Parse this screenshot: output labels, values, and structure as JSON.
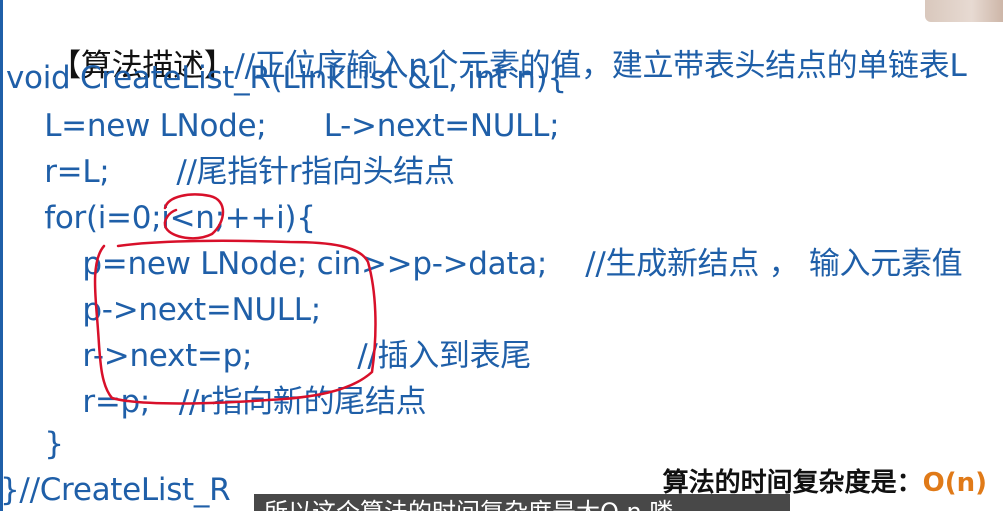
{
  "heading": {
    "label": "【算法描述】",
    "comment": "//正位序输入n个元素的值，建立带表头结点的单链表L"
  },
  "code_lines": [
    "void CreateList_R(LinkList &L, int n){",
    "    L=new LNode;      L->next=NULL;",
    "    r=L;       //尾指针r指向头结点",
    "    for(i=0;i<n;++i){",
    "        p=new LNode; cin>>p->data;    //生成新结点 ， 输入元素值",
    "        p->next=NULL;",
    "        r->next=p;           //插入到表尾",
    "        r=p;   //r指向新的尾结点",
    "    }",
    "}//CreateList_R"
  ],
  "complexity": {
    "label": "算法的时间复杂度是：",
    "value": "O(n)"
  },
  "subtitle": {
    "text": "所以这个算法的时间复杂度是大O n 喽"
  },
  "colors": {
    "code": "#1f5fa8",
    "accent": "#e07a18",
    "annotation": "#d8102a"
  }
}
